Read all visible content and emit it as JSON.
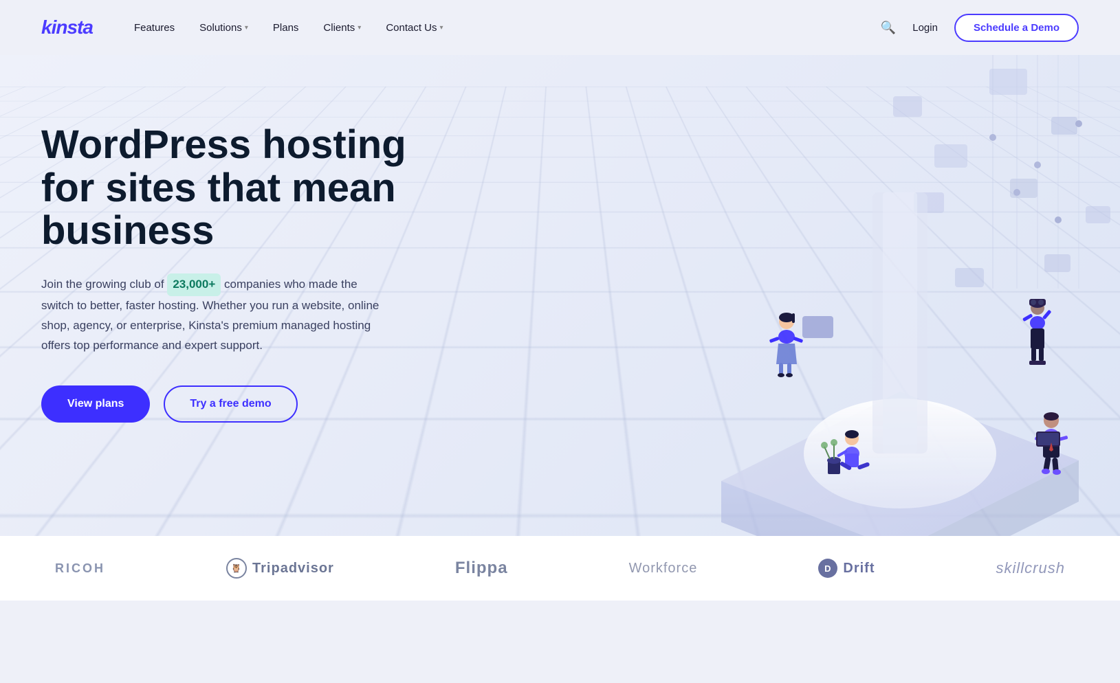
{
  "brand": {
    "name": "kinsta"
  },
  "nav": {
    "links": [
      {
        "id": "features",
        "label": "Features",
        "hasDropdown": false
      },
      {
        "id": "solutions",
        "label": "Solutions",
        "hasDropdown": true
      },
      {
        "id": "plans",
        "label": "Plans",
        "hasDropdown": false
      },
      {
        "id": "clients",
        "label": "Clients",
        "hasDropdown": true
      },
      {
        "id": "contact",
        "label": "Contact Us",
        "hasDropdown": true
      }
    ],
    "login_label": "Login",
    "cta_label": "Schedule a Demo"
  },
  "hero": {
    "title": "WordPress hosting for sites that mean business",
    "description_before": "Join the growing club of",
    "highlight": "23,000+",
    "description_after": "companies who made the switch to better, faster hosting. Whether you run a website, online shop, agency, or enterprise, Kinsta's premium managed hosting offers top performance and expert support.",
    "btn_primary": "View plans",
    "btn_secondary": "Try a free demo"
  },
  "clients": [
    {
      "id": "ricoh",
      "name": "RICOH",
      "style": "ricoh"
    },
    {
      "id": "tripadvisor",
      "name": "Tripadvisor",
      "style": "tripadvisor"
    },
    {
      "id": "flippa",
      "name": "Flippa",
      "style": "flippa"
    },
    {
      "id": "workforce",
      "name": "Workforce",
      "style": "workforce"
    },
    {
      "id": "drift",
      "name": "Drift",
      "style": "drift"
    },
    {
      "id": "skillcrush",
      "name": "skillcrush",
      "style": "skillcrush"
    }
  ],
  "colors": {
    "brand_purple": "#4b3bff",
    "dark_blue": "#0d1b2e",
    "bg_light": "#eef1fa",
    "highlight_green_bg": "#c8f0e8",
    "highlight_green_text": "#0d7a5f"
  }
}
